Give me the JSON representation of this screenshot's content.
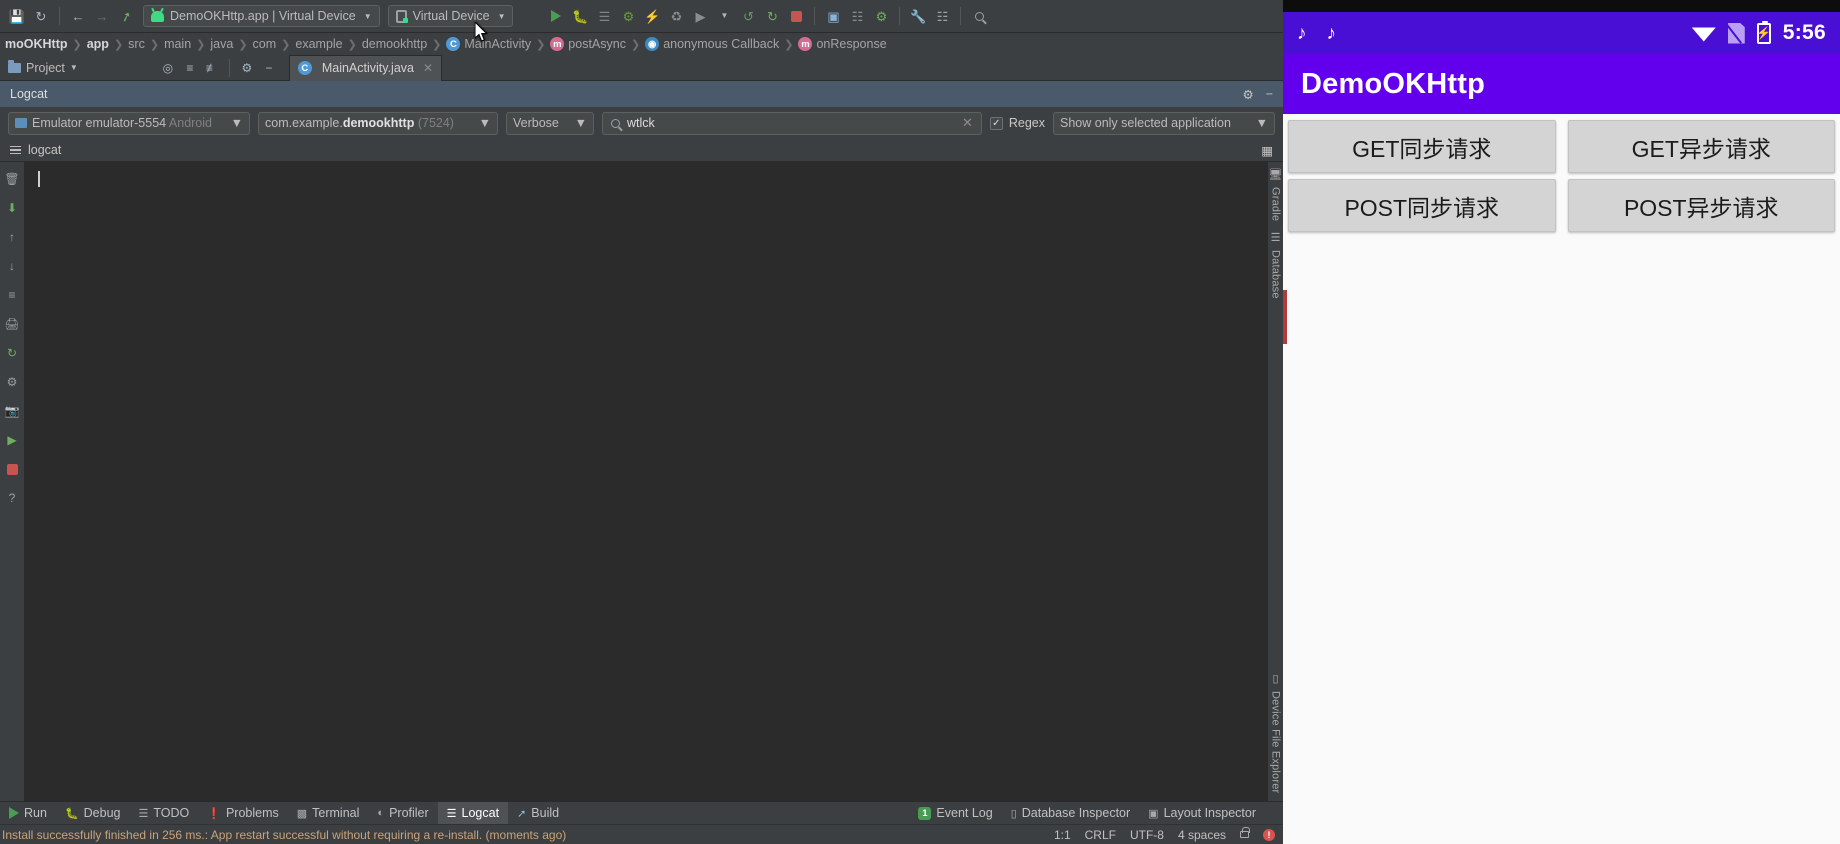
{
  "ide": {
    "toolbar": {
      "icons": [
        "save-icon",
        "sync-icon",
        "back-arrow-icon",
        "forward-arrow-icon",
        "build-hammer-icon"
      ],
      "run_config": "DemoOKHttp.app | Virtual Device",
      "device_selector": "Virtual Device",
      "right_icons": [
        "run-icon",
        "debug-icon",
        "stop-icon",
        "profiler-icon",
        "avd-manager-icon",
        "sdk-manager-icon",
        "search-icon",
        "layout-inspector-icon"
      ]
    },
    "breadcrumbs": [
      {
        "label": "moOKHttp",
        "kind": "project",
        "bold": true
      },
      {
        "label": "app",
        "kind": "module",
        "bold": true
      },
      {
        "label": "src",
        "kind": "dir"
      },
      {
        "label": "main",
        "kind": "dir"
      },
      {
        "label": "java",
        "kind": "dir"
      },
      {
        "label": "com",
        "kind": "package"
      },
      {
        "label": "example",
        "kind": "package"
      },
      {
        "label": "demookhttp",
        "kind": "package"
      },
      {
        "label": "MainActivity",
        "kind": "class"
      },
      {
        "label": "postAsync",
        "kind": "method"
      },
      {
        "label": "anonymous Callback",
        "kind": "lambda"
      },
      {
        "label": "onResponse",
        "kind": "method"
      }
    ],
    "project_button": "Project",
    "editor_tab": "MainActivity.java",
    "logcat": {
      "title": "Logcat",
      "device": "Emulator emulator-5554",
      "device_suffix": "Android",
      "process_prefix": "com.example.",
      "process_bold": "demookhttp",
      "process_pid": "(7524)",
      "level": "Verbose",
      "search_value": "wtlck",
      "search_placeholder": "Search",
      "regex_label": "Regex",
      "regex_checked": "✓",
      "scope": "Show only selected application",
      "tab_label": "logcat",
      "body_text": ""
    },
    "bottom_tools": [
      {
        "label": "Run",
        "icon": "run-icon",
        "active": false
      },
      {
        "label": "Debug",
        "icon": "debug-icon",
        "active": false
      },
      {
        "label": "TODO",
        "icon": "todo-icon",
        "active": false
      },
      {
        "label": "Problems",
        "icon": "problems-icon",
        "active": false
      },
      {
        "label": "Terminal",
        "icon": "terminal-icon",
        "active": false
      },
      {
        "label": "Profiler",
        "icon": "profiler-icon",
        "active": false
      },
      {
        "label": "Logcat",
        "icon": "logcat-icon",
        "active": true
      },
      {
        "label": "Build",
        "icon": "build-icon",
        "active": false
      }
    ],
    "bottom_right_tools": [
      {
        "label": "Event Log",
        "badge": "1"
      },
      {
        "label": "Database Inspector",
        "badge": ""
      },
      {
        "label": "Layout Inspector",
        "badge": ""
      }
    ],
    "right_strip": [
      "Gradle",
      "Database",
      "Device File Explorer"
    ],
    "status": {
      "message": "Install successfully finished in 256 ms.: App restart successful without requiring a re-install. (moments ago)",
      "caret": "1:1",
      "line_sep": "CRLF",
      "encoding": "UTF-8",
      "indent": "4 spaces",
      "lock_icon": "lock-icon",
      "error_icon": "error-icon"
    }
  },
  "emulator": {
    "status_bar": {
      "notif_icons": [
        "tiktok-icon",
        "tiktok-icon"
      ],
      "wifi_icon": "wifi-icon",
      "sim_icon": "sim-off-icon",
      "battery_icon": "battery-charging-icon",
      "time": "5:56"
    },
    "app_title": "DemoOKHttp",
    "buttons": [
      [
        "GET同步请求",
        "GET异步请求"
      ],
      [
        "POST同步请求",
        "POST异步请求"
      ]
    ]
  },
  "colors": {
    "ide_bg": "#3c3f41",
    "console_bg": "#2b2b2b",
    "logcat_header": "#4a5a6a",
    "accent_purple": "#6200ee",
    "status_purple": "#4a0fd4",
    "status_text": "#c9a37a",
    "green_run": "#499c54"
  }
}
